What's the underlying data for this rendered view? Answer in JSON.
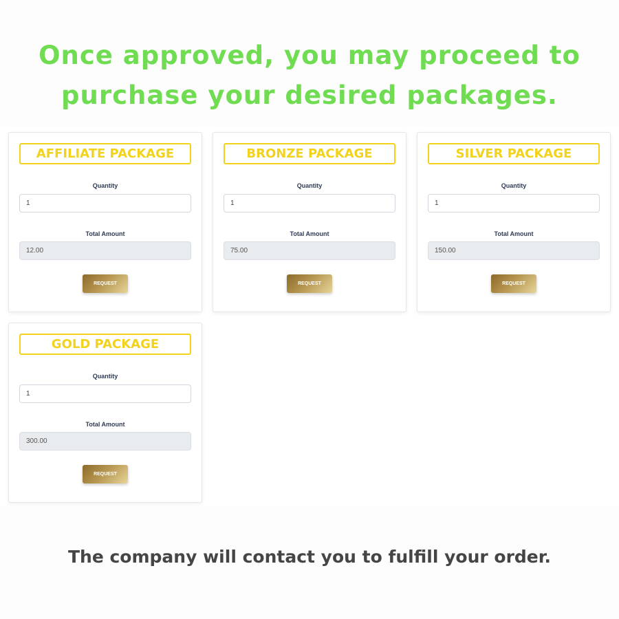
{
  "headline": {
    "line1": "Once approved, you may proceed to",
    "line2": "purchase your desired packages."
  },
  "packages": [
    {
      "title": "AFFILIATE PACKAGE",
      "quantity_label": "Quantity",
      "quantity": "1",
      "total_label": "Total Amount",
      "total": "12.00",
      "button": "REQUEST"
    },
    {
      "title": "BRONZE PACKAGE",
      "quantity_label": "Quantity",
      "quantity": "1",
      "total_label": "Total Amount",
      "total": "75.00",
      "button": "REQUEST"
    },
    {
      "title": "SILVER PACKAGE",
      "quantity_label": "Quantity",
      "quantity": "1",
      "total_label": "Total Amount",
      "total": "150.00",
      "button": "REQUEST"
    },
    {
      "title": "GOLD PACKAGE",
      "quantity_label": "Quantity",
      "quantity": "1",
      "total_label": "Total Amount",
      "total": "300.00",
      "button": "REQUEST"
    }
  ],
  "footer": "The company will contact you to fulfill your order.",
  "colors": {
    "headline": "#6fdc52",
    "card_title": "#f2d21a",
    "button_gradient_start": "#8c6a2c",
    "button_gradient_end": "#e7d59a",
    "footer_text": "#454545"
  }
}
